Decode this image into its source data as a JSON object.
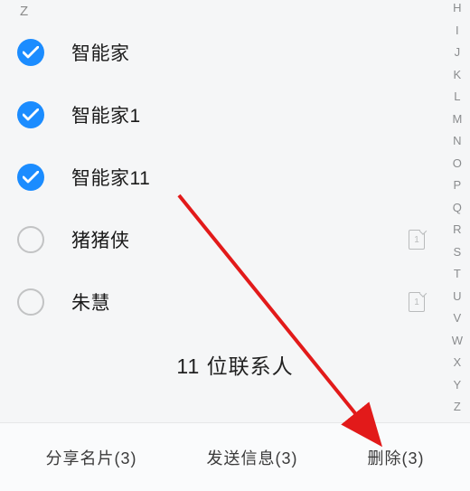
{
  "section_letter": "Z",
  "contacts": [
    {
      "name": "智能家",
      "checked": true,
      "sim": null
    },
    {
      "name": "智能家1",
      "checked": true,
      "sim": null
    },
    {
      "name": "智能家11",
      "checked": true,
      "sim": null
    },
    {
      "name": "猪猪侠",
      "checked": false,
      "sim": "1"
    },
    {
      "name": "朱慧",
      "checked": false,
      "sim": "1"
    }
  ],
  "index_letters": [
    "H",
    "I",
    "J",
    "K",
    "L",
    "M",
    "N",
    "O",
    "P",
    "Q",
    "R",
    "S",
    "T",
    "U",
    "V",
    "W",
    "X",
    "Y",
    "Z"
  ],
  "footer": "11 位联系人",
  "buttons": {
    "share": "分享名片(3)",
    "send": "发送信息(3)",
    "delete": "删除(3)"
  },
  "colors": {
    "accent": "#1b8cff",
    "arrow": "#e21a1a"
  }
}
